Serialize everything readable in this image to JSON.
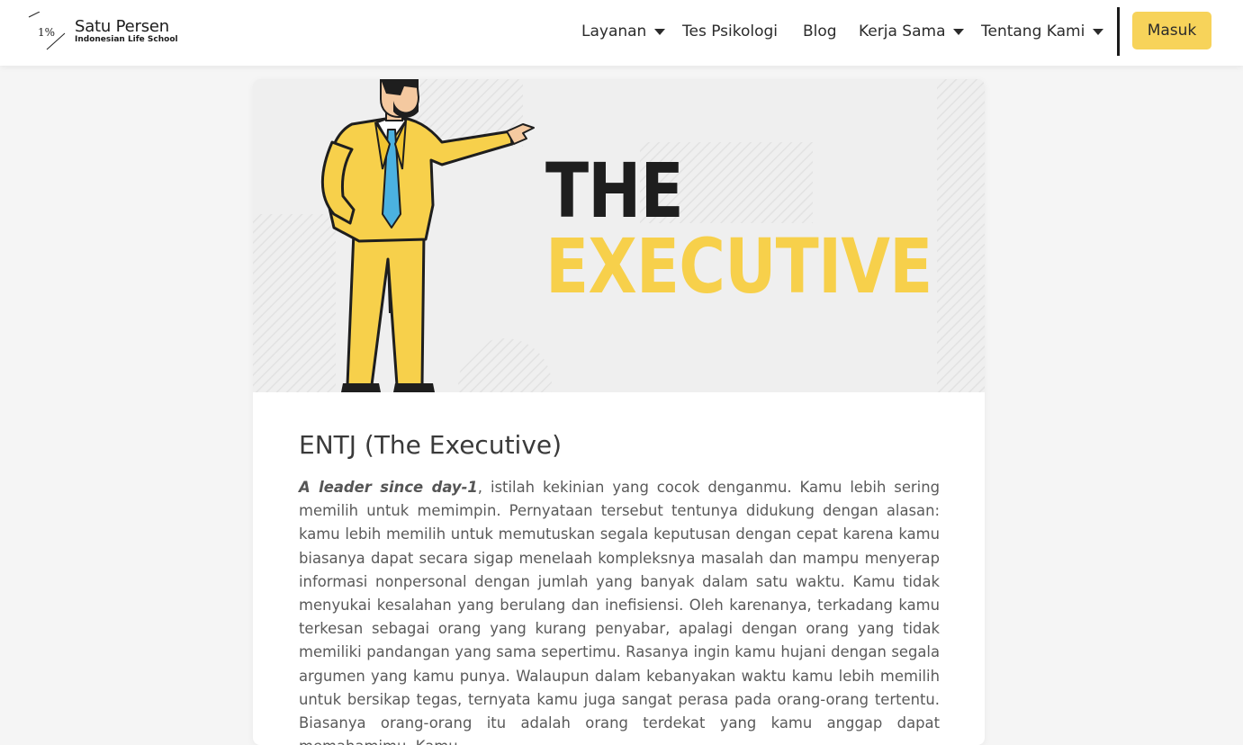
{
  "brand": {
    "mark_text": "1%",
    "name": "Satu Persen",
    "tagline": "Indonesian Life School"
  },
  "nav": {
    "items": [
      {
        "label": "Layanan",
        "has_dropdown": true
      },
      {
        "label": "Tes Psikologi",
        "has_dropdown": false
      },
      {
        "label": "Blog",
        "has_dropdown": false
      },
      {
        "label": "Kerja Sama",
        "has_dropdown": true
      },
      {
        "label": "Tentang Kami",
        "has_dropdown": true
      }
    ],
    "login_label": "Masuk"
  },
  "hero": {
    "line1": "THE",
    "line2": "EXECUTIVE",
    "illustration": "businessman-pointing-illustration"
  },
  "article": {
    "title": "ENTJ (The Executive)",
    "lead_emphasis": "A leader since day-1",
    "body": ", istilah kekinian yang cocok denganmu. Kamu lebih sering memilih untuk memimpin. Pernyataan tersebut tentunya didukung dengan alasan: kamu lebih memilih untuk memutuskan segala keputusan dengan cepat karena kamu biasanya dapat secara sigap menelaah kompleksnya masalah dan mampu menyerap informasi nonpersonal dengan jumlah yang banyak dalam satu waktu. Kamu tidak menyukai kesalahan yang berulang dan inefisiensi. Oleh karenanya, terkadang kamu terkesan sebagai orang yang kurang penyabar, apalagi dengan orang yang tidak memiliki pandangan yang sama sepertimu. Rasanya ingin kamu hujani dengan segala argumen yang kamu punya. Walaupun dalam kebanyakan waktu kamu lebih memilih untuk bersikap tegas, ternyata kamu juga sangat perasa pada orang-orang tertentu. Biasanya orang-orang itu adalah orang terdekat yang kamu anggap dapat memahamimu. Kamu"
  },
  "colors": {
    "accent_yellow": "#f7d35a",
    "text_dark": "#2b2b2b",
    "body_text": "#5a5a5a"
  }
}
